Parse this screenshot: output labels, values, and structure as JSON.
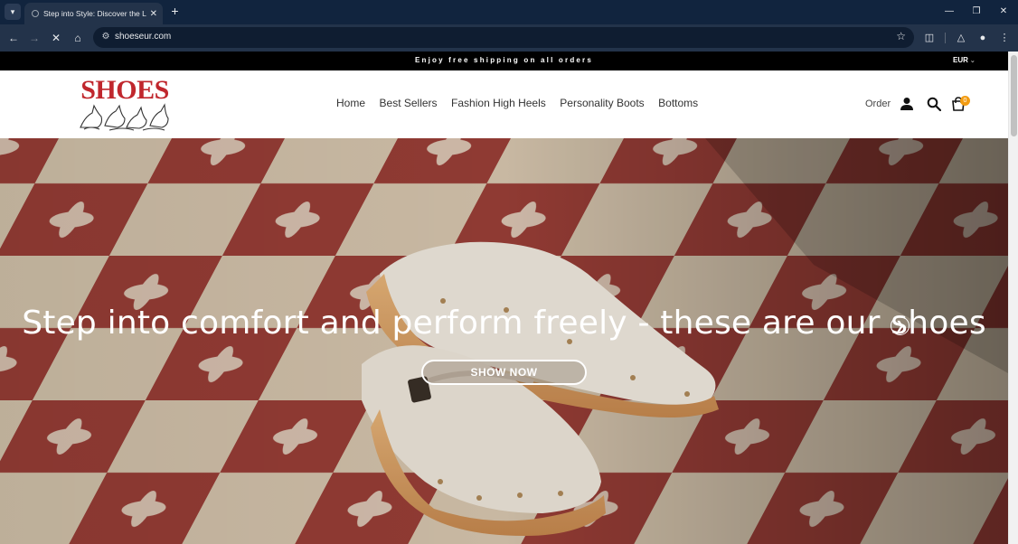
{
  "browser": {
    "tab_title": "Step into Style: Discover the Latest",
    "url": "shoeseur.com"
  },
  "announcement": {
    "text": "Enjoy free shipping on all orders",
    "currency": "EUR"
  },
  "header": {
    "logo_text": "SHOES",
    "nav": [
      "Home",
      "Best Sellers",
      "Fashion High Heels",
      "Personality Boots",
      "Bottoms"
    ],
    "order_label": "Order",
    "cart_count": "0"
  },
  "hero": {
    "title": "Step into comfort and perform freely - these are our shoes",
    "button_label": "SHOW NOW"
  },
  "colors": {
    "brand_red": "#c0272d",
    "badge": "#f39c12",
    "chrome_dark": "#11243e"
  }
}
